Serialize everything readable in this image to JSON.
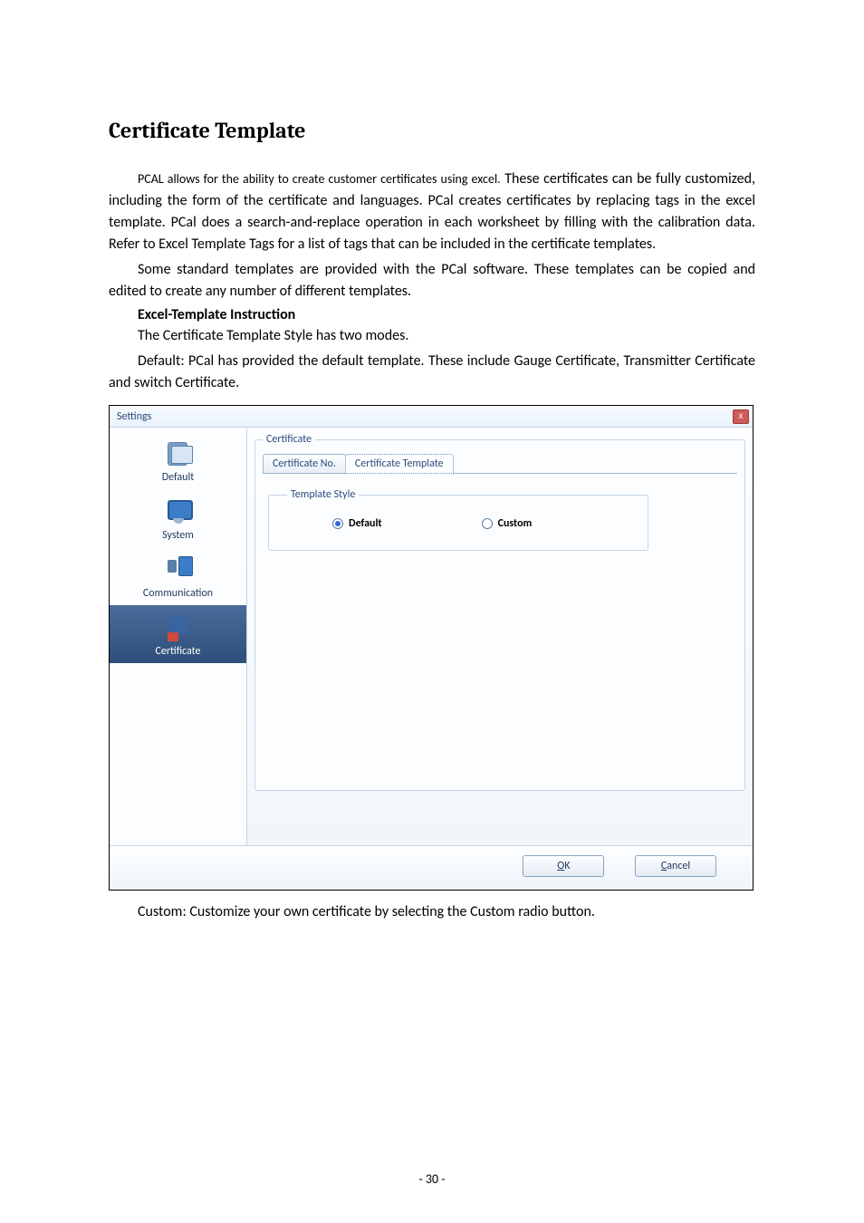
{
  "doc": {
    "heading": "Certificate Template",
    "para1_a": "PCAL allows for the ability to create customer certificates using excel.",
    "para1_b": " These certificates can be fully customized, including the form of the certificate and languages. PCal creates certificates by replacing tags in the excel template. PCal does a search-and-replace operation in each worksheet by filling with the calibration data. Refer to Excel Template Tags for a list of tags that can be included in the certificate templates.",
    "para2": "Some standard templates are provided with the PCal software. These templates can be copied and edited to create any number of different templates.",
    "subhead": "Excel-Template Instruction",
    "para3": "The Certificate Template Style has two modes.",
    "para4": "Default: PCal has provided the default template. These include Gauge Certificate, Transmitter Certificate and switch Certificate.",
    "caption": "Custom: Customize your own certificate by selecting the Custom radio button.",
    "page_number": "- 30 -"
  },
  "dialog": {
    "title": "Settings",
    "close_glyph": "x",
    "sidebar": {
      "items": [
        {
          "label": "Default"
        },
        {
          "label": "System"
        },
        {
          "label": "Communication"
        },
        {
          "label": "Certificate"
        }
      ]
    },
    "group_legend": "Certificate",
    "tabs": {
      "t1": "Certificate No.",
      "t2": "Certificate Template"
    },
    "template_style_legend": "Template Style",
    "radios": {
      "r1": "Default",
      "r2": "Custom"
    },
    "buttons": {
      "ok_u": "O",
      "ok_rest": "K",
      "cancel_u": "C",
      "cancel_rest": "ancel"
    }
  }
}
